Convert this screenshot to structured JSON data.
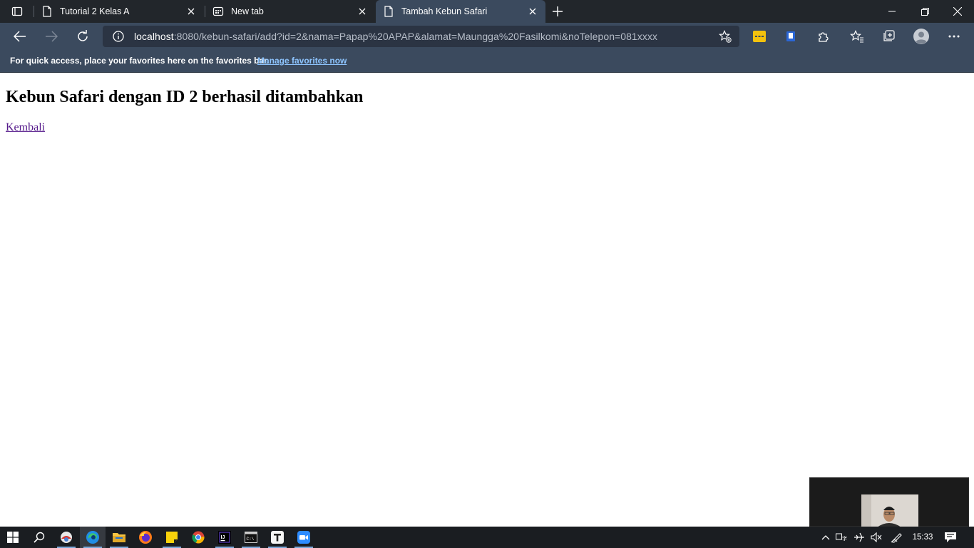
{
  "browser": {
    "tabs": [
      {
        "title": "Tutorial 2 Kelas A",
        "icon": "page-icon"
      },
      {
        "title": "New tab",
        "icon": "newtab-icon"
      },
      {
        "title": "Tambah Kebun Safari",
        "icon": "page-icon",
        "active": true
      }
    ],
    "address": {
      "host": "localhost",
      "rest": ":8080/kebun-safari/add?id=2&nama=Papap%20APAP&alamat=Maungga%20Fasilkomi&noTelepon=081xxxx"
    },
    "favorites_bar": {
      "message": "For quick access, place your favorites here on the favorites bar.",
      "link": "Manage favorites now"
    }
  },
  "page": {
    "heading": "Kebun Safari dengan ID 2 berhasil ditambahkan",
    "link": "Kembali"
  },
  "taskbar": {
    "clock": "15:33"
  },
  "colors": {
    "chrome_bg": "#3b4a5e",
    "tabstrip_bg": "#22262b",
    "link_visited": "#551a8b",
    "favbar_link": "#8ec5ff"
  }
}
